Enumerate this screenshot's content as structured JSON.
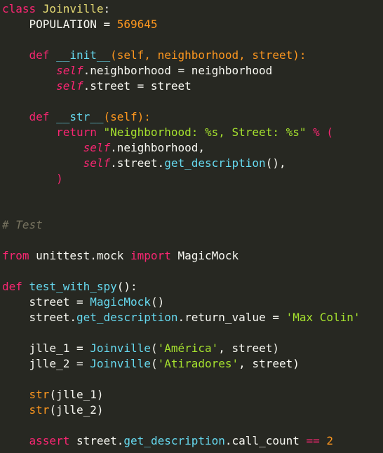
{
  "colors": {
    "background": "#272822",
    "plain": "#f8f8f2",
    "keyword": "#f92672",
    "class_name": "#e6db74",
    "function": "#66d9ef",
    "param": "#fd971f",
    "number": "#ae81ff",
    "string": "#a6e22e",
    "comment": "#75715e"
  },
  "editor": {
    "lines": [
      [
        {
          "t": "class ",
          "c": "keyword"
        },
        {
          "t": "Joinville",
          "c": "class_name"
        },
        {
          "t": ":",
          "c": "plain"
        }
      ],
      [
        {
          "t": "    POPULATION = ",
          "c": "plain"
        },
        {
          "t": "569645",
          "c": "param"
        }
      ],
      [],
      [
        {
          "t": "    ",
          "c": "plain"
        },
        {
          "t": "def ",
          "c": "keyword"
        },
        {
          "t": "__init__",
          "c": "function"
        },
        {
          "t": "(",
          "c": "param"
        },
        {
          "t": "self",
          "c": "param"
        },
        {
          "t": ", ",
          "c": "param"
        },
        {
          "t": "neighborhood",
          "c": "param"
        },
        {
          "t": ", ",
          "c": "param"
        },
        {
          "t": "street",
          "c": "param"
        },
        {
          "t": "):",
          "c": "param"
        }
      ],
      [
        {
          "t": "        ",
          "c": "plain"
        },
        {
          "t": "self",
          "c": "self"
        },
        {
          "t": ".neighborhood = neighborhood",
          "c": "plain"
        }
      ],
      [
        {
          "t": "        ",
          "c": "plain"
        },
        {
          "t": "self",
          "c": "self"
        },
        {
          "t": ".street = street",
          "c": "plain"
        }
      ],
      [],
      [
        {
          "t": "    ",
          "c": "plain"
        },
        {
          "t": "def ",
          "c": "keyword"
        },
        {
          "t": "__str__",
          "c": "function"
        },
        {
          "t": "(",
          "c": "param"
        },
        {
          "t": "self",
          "c": "param"
        },
        {
          "t": "):",
          "c": "param"
        }
      ],
      [
        {
          "t": "        ",
          "c": "plain"
        },
        {
          "t": "return ",
          "c": "keyword"
        },
        {
          "t": "\"Neighborhood: %s, Street: %s\" ",
          "c": "string"
        },
        {
          "t": "% (",
          "c": "keyword"
        }
      ],
      [
        {
          "t": "            ",
          "c": "plain"
        },
        {
          "t": "self",
          "c": "self"
        },
        {
          "t": ".neighborhood,",
          "c": "plain"
        }
      ],
      [
        {
          "t": "            ",
          "c": "plain"
        },
        {
          "t": "self",
          "c": "self"
        },
        {
          "t": ".street.",
          "c": "plain"
        },
        {
          "t": "get_description",
          "c": "function"
        },
        {
          "t": "(),",
          "c": "plain"
        }
      ],
      [
        {
          "t": "        )",
          "c": "keyword"
        }
      ],
      [],
      [],
      [
        {
          "t": "# Test",
          "c": "comment"
        }
      ],
      [],
      [
        {
          "t": "from ",
          "c": "keyword"
        },
        {
          "t": "unittest.mock ",
          "c": "plain"
        },
        {
          "t": "import ",
          "c": "keyword"
        },
        {
          "t": "MagicMock",
          "c": "plain"
        }
      ],
      [],
      [
        {
          "t": "def ",
          "c": "keyword"
        },
        {
          "t": "test_with_spy",
          "c": "function"
        },
        {
          "t": "():",
          "c": "plain"
        }
      ],
      [
        {
          "t": "    street = ",
          "c": "plain"
        },
        {
          "t": "MagicMock",
          "c": "function"
        },
        {
          "t": "()",
          "c": "plain"
        }
      ],
      [
        {
          "t": "    street.",
          "c": "plain"
        },
        {
          "t": "get_description",
          "c": "function"
        },
        {
          "t": ".return_value = ",
          "c": "plain"
        },
        {
          "t": "'Max Colin'",
          "c": "string"
        }
      ],
      [],
      [
        {
          "t": "    jlle_1 = ",
          "c": "plain"
        },
        {
          "t": "Joinville",
          "c": "function"
        },
        {
          "t": "(",
          "c": "plain"
        },
        {
          "t": "'América'",
          "c": "string"
        },
        {
          "t": ", street)",
          "c": "plain"
        }
      ],
      [
        {
          "t": "    jlle_2 = ",
          "c": "plain"
        },
        {
          "t": "Joinville",
          "c": "function"
        },
        {
          "t": "(",
          "c": "plain"
        },
        {
          "t": "'Atiradores'",
          "c": "string"
        },
        {
          "t": ", street)",
          "c": "plain"
        }
      ],
      [],
      [
        {
          "t": "    ",
          "c": "plain"
        },
        {
          "t": "str",
          "c": "param"
        },
        {
          "t": "(jlle_1)",
          "c": "plain"
        }
      ],
      [
        {
          "t": "    ",
          "c": "plain"
        },
        {
          "t": "str",
          "c": "param"
        },
        {
          "t": "(jlle_2)",
          "c": "plain"
        }
      ],
      [],
      [
        {
          "t": "    ",
          "c": "plain"
        },
        {
          "t": "assert ",
          "c": "keyword"
        },
        {
          "t": "street.",
          "c": "plain"
        },
        {
          "t": "get_description",
          "c": "function"
        },
        {
          "t": ".call_count ",
          "c": "plain"
        },
        {
          "t": "== ",
          "c": "keyword"
        },
        {
          "t": "2",
          "c": "param"
        }
      ]
    ]
  }
}
